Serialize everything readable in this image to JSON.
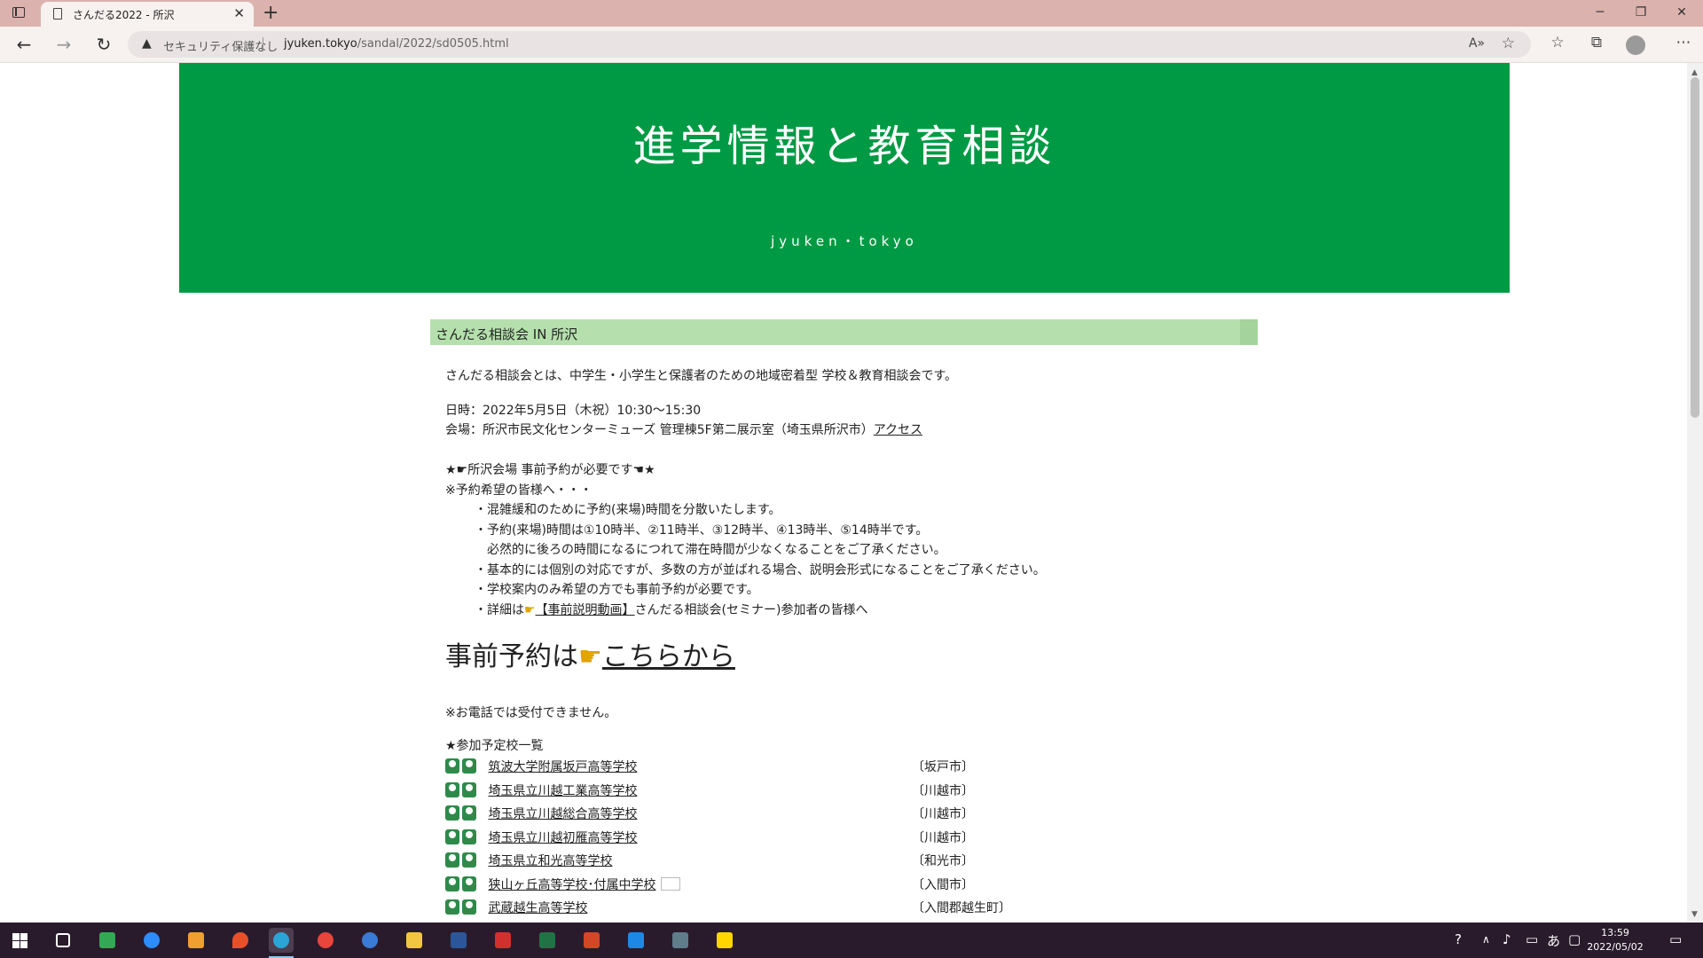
{
  "browser": {
    "tab_title": "さんだる2022 - 所沢",
    "security_label": "セキュリティ保護なし",
    "url_host": "jyuken.tokyo",
    "url_path": "/sandal/2022/sd0505.html"
  },
  "page": {
    "hero_title": "進学情報と教育相談",
    "hero_subtitle": "jyuken・tokyo",
    "section_title": "さんだる相談会 IN 所沢",
    "intro": "さんだる相談会とは、中学生・小学生と保護者のための地域密着型 学校＆教育相談会です。",
    "date_line": "日時：2022年5月5日（木祝）10:30～15:30",
    "venue_line": "会場：所沢市民文化センターミューズ 管理棟5F第二展示室（埼玉県所沢市）",
    "access_link": "アクセス",
    "reservation_heading": "★☛所沢会場 事前予約が必要です☚★",
    "reservation_note": "※予約希望の皆様へ・・・",
    "bullets": [
      "・混雑緩和のために予約(来場)時間を分散いたします。",
      "・予約(来場)時間は①10時半、②11時半、③12時半、④13時半、⑤14時半です。",
      "　必然的に後ろの時間になるにつれて滞在時間が少なくなることをご了承ください。",
      "・基本的には個別の対応ですが、多数の方が並ばれる場合、説明会形式になることをご了承ください。",
      "・学校案内のみ希望の方でも事前予約が必要です。"
    ],
    "details_prefix": "・詳細は",
    "details_link": "【事前説明動画】",
    "details_suffix": "さんだる相談会(セミナー)参加者の皆様へ",
    "big_prefix": "事前予約は",
    "big_link": "こちらから",
    "phone_note": "※お電話では受付できません。",
    "schools_heading": "★参加予定校一覧",
    "schools": [
      {
        "name": "筑波大学附属坂戸高等学校",
        "city": "〔坂戸市〕"
      },
      {
        "name": "埼玉県立川越工業高等学校",
        "city": "〔川越市〕"
      },
      {
        "name": "埼玉県立川越総合高等学校",
        "city": "〔川越市〕"
      },
      {
        "name": "埼玉県立川越初雁高等学校",
        "city": "〔川越市〕"
      },
      {
        "name": "埼玉県立和光高等学校",
        "city": "〔和光市〕"
      },
      {
        "name": "狭山ヶ丘高等学校･付属中学校",
        "city": "〔入間市〕"
      },
      {
        "name": "武蔵越生高等学校",
        "city": "〔入間郡越生町〕"
      }
    ]
  },
  "taskbar": {
    "ime": "あ",
    "time": "13:59",
    "date": "2022/05/02"
  },
  "colors": {
    "hero_green": "#009a44",
    "section_bar": "#b5e0ad",
    "tabbar": "#dbb2ad",
    "taskbar": "#2a1b2c"
  }
}
